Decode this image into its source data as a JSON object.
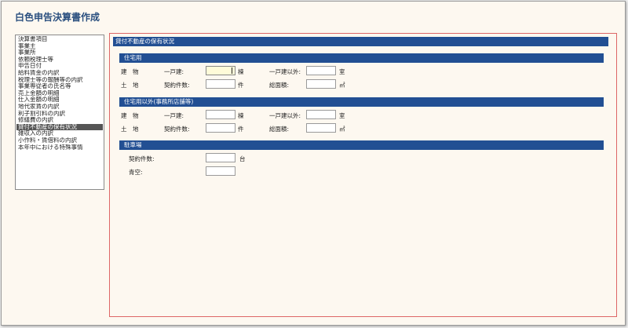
{
  "window": {
    "title": "白色申告決算書作成"
  },
  "menu": {
    "items": [
      "決算書項目",
      "事業主",
      "事業所",
      "依頼税理士等",
      "申告日付",
      "給料賃金の内訳",
      "税理士等の報酬等の内訳",
      "事業専従者の氏名等",
      "売上金額の明細",
      "仕入金額の明細",
      "地代家賃の内訳",
      "利子割引料の内訳",
      "修繕費の内訳",
      "貸付不動産の保有状況",
      "雑収入の内訳",
      "小作料・賃借料の内訳",
      "本年中における特殊事情"
    ],
    "selected_index": 13
  },
  "content": {
    "header": "貸付不動産の保有状況",
    "residential": {
      "title": "住宅用",
      "building_label": "建　物",
      "land_label": "土　地",
      "detached_label": "一戸建:",
      "detached_unit": "棟",
      "non_detached_label": "一戸建以外:",
      "non_detached_unit": "室",
      "contracts_label": "契約件数:",
      "contracts_unit": "件",
      "area_label": "総面積:",
      "area_unit": "㎡",
      "detached_value": "",
      "non_detached_value": "",
      "contracts_value": "",
      "area_value": ""
    },
    "non_residential": {
      "title": "住宅用以外(事務所店舗等)",
      "building_label": "建　物",
      "land_label": "土　地",
      "detached_label": "一戸建:",
      "detached_unit": "棟",
      "non_detached_label": "一戸建以外:",
      "non_detached_unit": "室",
      "contracts_label": "契約件数:",
      "contracts_unit": "件",
      "area_label": "総面積:",
      "area_unit": "㎡",
      "detached_value": "",
      "non_detached_value": "",
      "contracts_value": "",
      "area_value": ""
    },
    "parking": {
      "title": "駐車場",
      "contracts_label": "契約件数:",
      "contracts_unit": "台",
      "open_air_label": "青空:",
      "contracts_value": "",
      "open_air_value": ""
    }
  }
}
